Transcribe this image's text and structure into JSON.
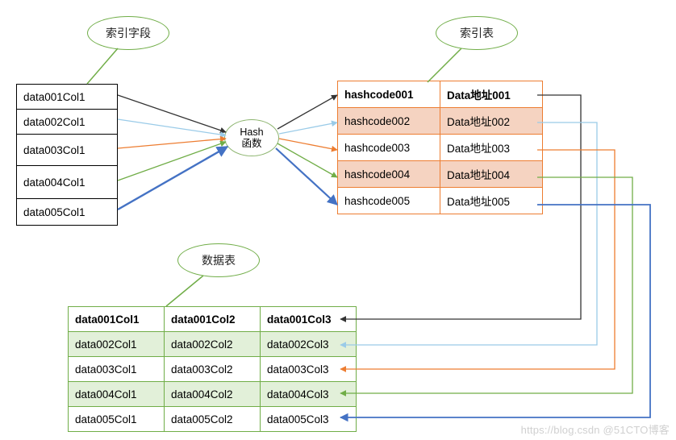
{
  "labels": {
    "index_field": "索引字段",
    "index_table": "索引表",
    "data_table": "数据表",
    "hash_fn_l1": "Hash",
    "hash_fn_l2": "函数"
  },
  "field_table": {
    "rows": [
      "data001Col1",
      "data002Col1",
      "data003Col1",
      "data004Col1",
      "data005Col1"
    ]
  },
  "index_table": {
    "header": [
      "hashcode001",
      "Data地址001"
    ],
    "rows": [
      {
        "c": [
          "hashcode002",
          "Data地址002"
        ],
        "shaded": true
      },
      {
        "c": [
          "hashcode003",
          "Data地址003"
        ],
        "shaded": false
      },
      {
        "c": [
          "hashcode004",
          "Data地址004"
        ],
        "shaded": true
      },
      {
        "c": [
          "hashcode005",
          "Data地址005"
        ],
        "shaded": false
      }
    ]
  },
  "data_table": {
    "header": [
      "data001Col1",
      "data001Col2",
      "data001Col3"
    ],
    "rows": [
      {
        "c": [
          "data002Col1",
          "data002Col2",
          "data002Col3"
        ],
        "shaded": true
      },
      {
        "c": [
          "data003Col1",
          "data003Col2",
          "data003Col3"
        ],
        "shaded": false
      },
      {
        "c": [
          "data004Col1",
          "data004Col2",
          "data004Col3"
        ],
        "shaded": true
      },
      {
        "c": [
          "data005Col1",
          "data005Col2",
          "data005Col3"
        ],
        "shaded": false
      }
    ]
  },
  "arrow_colors": {
    "c1": "#333333",
    "c2": "#9acbe8",
    "c3": "#ed7d31",
    "c4": "#70ad47",
    "c5": "#4472c4"
  },
  "watermark": "https://blog.csdn  @51CTO博客"
}
